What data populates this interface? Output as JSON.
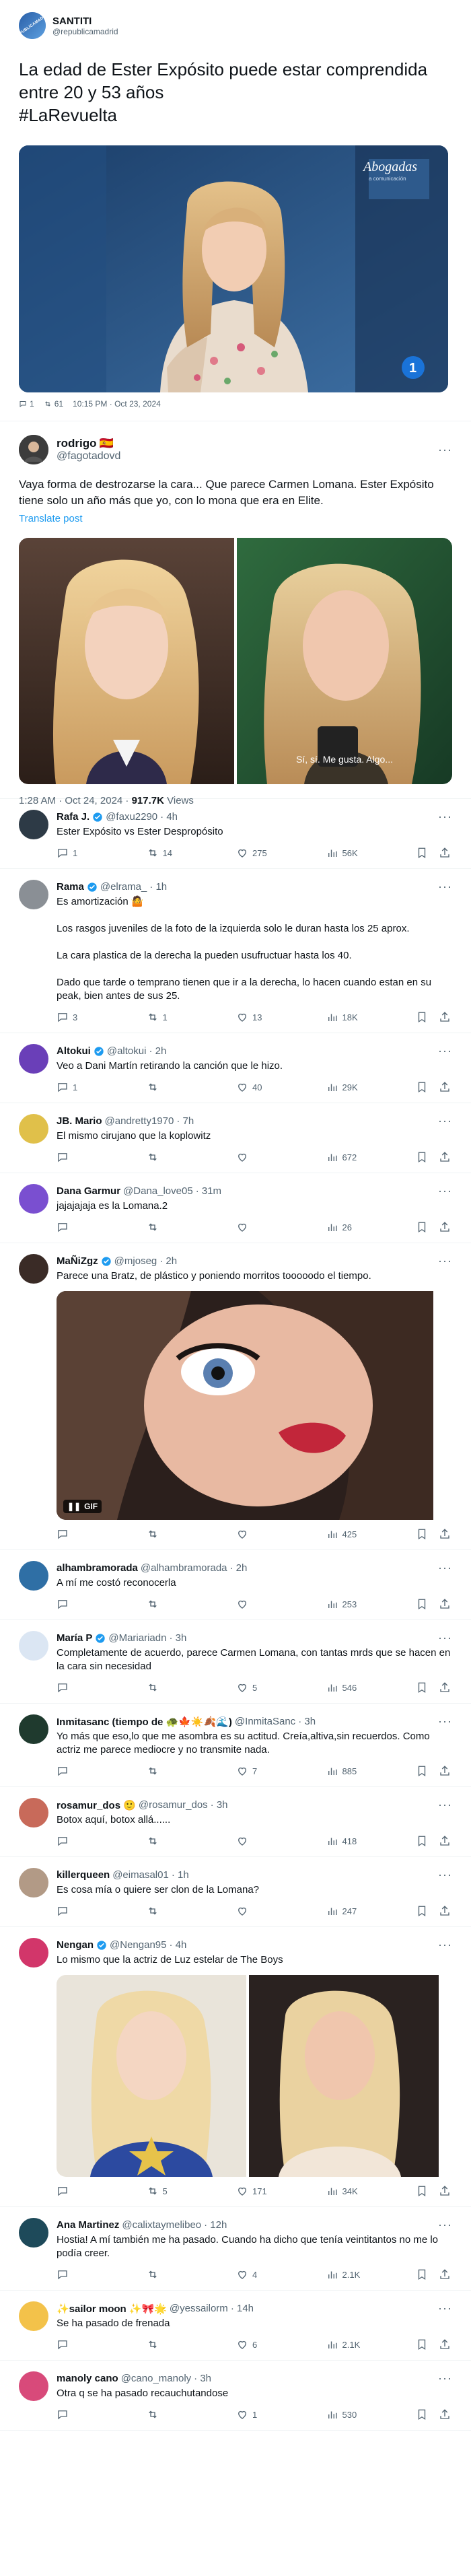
{
  "quoted": {
    "author_name": "SANTITI",
    "author_handle": "@republicamadrid",
    "avatar_text": "REPUBLICAMADRID",
    "text": "La edad de Ester Expósito puede estar comprendida entre 20 y 53 años\n#LaRevuelta",
    "tv_logo": "Abogadas",
    "tv_sub": "a comunicación",
    "channel": "1",
    "replies": "1",
    "reposts": "61",
    "timestamp": "10:15 PM · Oct 23, 2024"
  },
  "main": {
    "name": "rodrigo",
    "flag": "🇪🇸",
    "handle": "@fagotadovd",
    "text": "Vaya forma de destrozarse la cara... Que parece Carmen Lomana. Ester Expósito tiene solo un año más que yo, con lo mona que era en Elite.",
    "translate": "Translate post",
    "subtitle": "Sí, sí. Me gusta. Algo...",
    "timestamp": "1:28 AM · Oct 24, 2024 · ",
    "views": "917.7K",
    "views_label": " Views"
  },
  "replies": [
    {
      "name": "Rafa J.",
      "verified": true,
      "handle": "@faxu2290",
      "time": "· 4h",
      "text": "Ester Expósito vs Ester Despropósito",
      "comments": "1",
      "reposts": "14",
      "likes": "275",
      "views": "56K",
      "avatar_color": "#2d3a46"
    },
    {
      "name": "Rama",
      "verified": true,
      "handle": "@elrama_",
      "time": "· 1h",
      "text": "Es amortización 🤷\n\nLos rasgos juveniles de la foto de la izquierda solo le duran hasta los 25 aprox.\n\nLa cara plastica de la derecha la pueden usufructuar hasta los 40.\n\nDado que tarde o temprano tienen que ir a la derecha, lo hacen cuando estan en su peak, bien antes de sus 25.",
      "comments": "3",
      "reposts": "1",
      "likes": "13",
      "views": "18K",
      "avatar_color": "#8a8f95"
    },
    {
      "name": "Altokui",
      "verified": true,
      "handle": "@altokui",
      "time": "· 2h",
      "text": "Veo a Dani Martín retirando la canción que le hizo.",
      "comments": "1",
      "reposts": "",
      "likes": "40",
      "views": "29K",
      "avatar_color": "#6a3fb8"
    },
    {
      "name": "JB. Mario",
      "verified": false,
      "handle": "@andretty1970",
      "time": "· 7h",
      "text": "El mismo cirujano que la koplowitz",
      "comments": "",
      "reposts": "",
      "likes": "",
      "views": "672",
      "avatar_color": "#e0c04a"
    },
    {
      "name": "Dana Garmur",
      "verified": false,
      "handle": "@Dana_love05",
      "time": "· 31m",
      "text": "jajajajaja es la Lomana.2",
      "comments": "",
      "reposts": "",
      "likes": "",
      "views": "26",
      "avatar_color": "#7a4fd0"
    },
    {
      "name": "MaÑiZgz",
      "verified": true,
      "handle": "@mjoseg",
      "time": "· 2h",
      "text": "Parece una Bratz, de plástico y poniendo morritos tooooodo el tiempo.",
      "comments": "",
      "reposts": "",
      "likes": "",
      "views": "425",
      "avatar_color": "#3a2b26",
      "gif_label": "GIF"
    },
    {
      "name": "alhambramorada",
      "verified": false,
      "handle": "@alhambramorada",
      "time": "· 2h",
      "text": "A mí me costó reconocerla",
      "comments": "",
      "reposts": "",
      "likes": "",
      "views": "253",
      "avatar_color": "#2f6fa5"
    },
    {
      "name": "María P",
      "verified": true,
      "handle": "@Mariariadn",
      "time": "· 3h",
      "text": "Completamente de acuerdo, parece Carmen Lomana, con tantas mrds que se hacen en la cara sin necesidad",
      "comments": "",
      "reposts": "",
      "likes": "5",
      "views": "546",
      "avatar_color": "#dbe6f3"
    },
    {
      "name": "Inmitasanc (tiempo de 🐢🍁☀️🍂🌊)",
      "verified": false,
      "handle": "@InmitaSanc",
      "time": "· 3h",
      "text": "Yo más que eso,lo que me asombra es su actitud. Creía,altiva,sin recuerdos. Como actriz me parece mediocre y no transmite nada.",
      "comments": "",
      "reposts": "",
      "likes": "7",
      "views": "885",
      "avatar_color": "#1f3a2e"
    },
    {
      "name": "rosamur_dos 🙂",
      "verified": false,
      "handle": "@rosamur_dos",
      "time": "· 3h",
      "text": "Botox aquí, botox allá......",
      "comments": "",
      "reposts": "",
      "likes": "",
      "views": "418",
      "avatar_color": "#c86a5a"
    },
    {
      "name": "killerqueen",
      "verified": false,
      "handle": "@eimasal01",
      "time": "· 1h",
      "text": "Es cosa mía o quiere ser clon de la Lomana?",
      "comments": "",
      "reposts": "",
      "likes": "",
      "views": "247",
      "avatar_color": "#b29a86"
    },
    {
      "name": "Nengan",
      "verified": true,
      "handle": "@Nengan95",
      "time": "· 4h",
      "text": "Lo mismo que la actriz de Luz estelar de The Boys",
      "comments": "",
      "reposts": "5",
      "likes": "171",
      "views": "34K",
      "avatar_color": "#d2366a"
    },
    {
      "name": "Ana Martinez",
      "verified": false,
      "handle": "@calixtaymelibeo",
      "time": "· 12h",
      "text": "Hostia! A mí también me ha pasado. Cuando ha dicho que tenía veintitantos no me lo podía creer.",
      "comments": "",
      "reposts": "",
      "likes": "4",
      "views": "2.1K",
      "avatar_color": "#1e4a5a"
    },
    {
      "name": "✨sailor moon ✨🎀🌟",
      "verified": false,
      "handle": "@yessailorm",
      "time": "· 14h",
      "text": "Se ha pasado de frenada",
      "comments": "",
      "reposts": "",
      "likes": "6",
      "views": "2.1K",
      "avatar_color": "#f3c24a"
    },
    {
      "name": "manoly cano",
      "verified": false,
      "handle": "@cano_manoly",
      "time": "· 3h",
      "text": "Otra q se ha pasado recauchutandose",
      "comments": "",
      "reposts": "",
      "likes": "1",
      "views": "530",
      "avatar_color": "#d84a7a"
    }
  ]
}
